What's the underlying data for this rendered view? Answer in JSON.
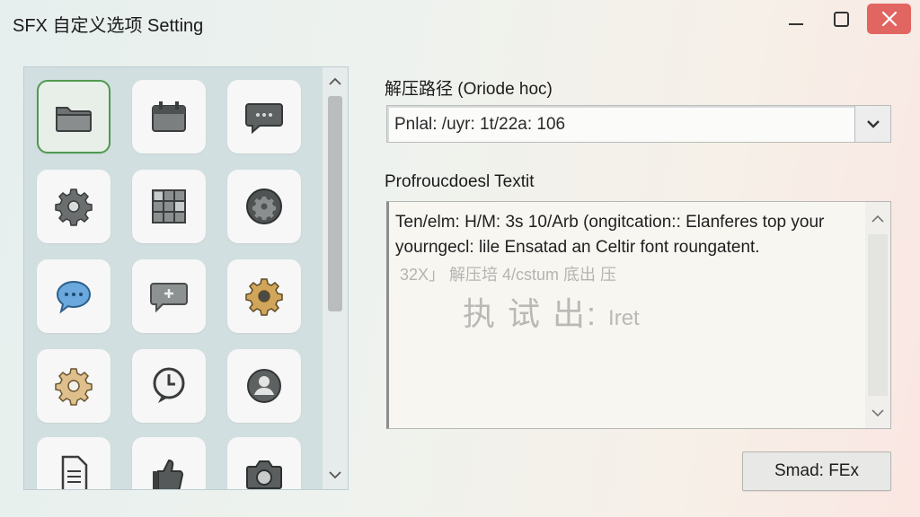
{
  "window": {
    "title": "SFX 自定义选项 Setting"
  },
  "icon_grid": {
    "tiles": [
      {
        "icon": "folder-icon",
        "selected": true
      },
      {
        "icon": "calendar-icon",
        "selected": false
      },
      {
        "icon": "chat-bubble-icon",
        "selected": false
      },
      {
        "icon": "gear-icon",
        "selected": false
      },
      {
        "icon": "grid-icon",
        "selected": false
      },
      {
        "icon": "gear-dark-icon",
        "selected": false
      },
      {
        "icon": "message-blue-icon",
        "selected": false
      },
      {
        "icon": "message-add-icon",
        "selected": false
      },
      {
        "icon": "gear-gold-icon",
        "selected": false
      },
      {
        "icon": "gear-gold-icon",
        "selected": false
      },
      {
        "icon": "clock-bubble-icon",
        "selected": false
      },
      {
        "icon": "user-icon",
        "selected": false
      },
      {
        "icon": "document-icon",
        "selected": false
      },
      {
        "icon": "thumbs-up-icon",
        "selected": false
      },
      {
        "icon": "camera-icon",
        "selected": false
      }
    ]
  },
  "path_section": {
    "label": "解压路径 (Oriode hoc)",
    "value": "Pnlal: /uyr: 1t/22a: 106"
  },
  "text_section": {
    "label": "Profroucdoesl Textit",
    "line1": "Ten/elm: H/M: 3s 10/Arb (ongitcation:: Elanferes top your",
    "line2": "yourngecl: lile Ensatad an Celtir font roungatent.",
    "line3": "32X」 解压培 4/cstum 底出 压",
    "line4_big": "执 试 出:",
    "line4_small": "Iret"
  },
  "action_button": {
    "label": "Smad: FEx"
  },
  "colors": {
    "accent_selected": "#4f9a4e",
    "close_button": "#e16561",
    "panel_bg": "#d2dfe1"
  }
}
